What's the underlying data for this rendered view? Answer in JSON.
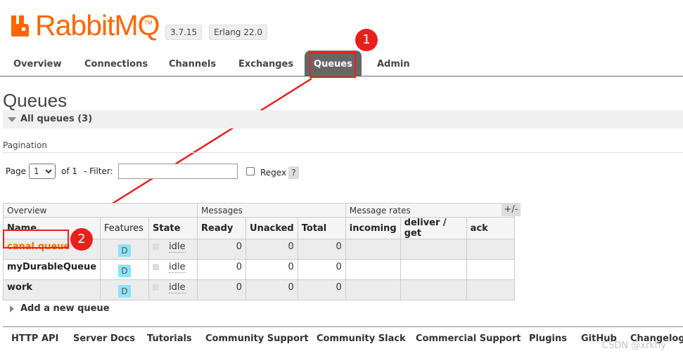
{
  "header": {
    "logo_text": "RabbitMQ",
    "logo_tm": "TM",
    "version": "3.7.15",
    "erlang": "Erlang 22.0"
  },
  "tabs": [
    {
      "label": "Overview"
    },
    {
      "label": "Connections"
    },
    {
      "label": "Channels"
    },
    {
      "label": "Exchanges"
    },
    {
      "label": "Queues",
      "active": true
    },
    {
      "label": "Admin"
    }
  ],
  "page": {
    "title": "Queues",
    "section_title": "All queues (3)"
  },
  "pagination": {
    "label": "Pagination",
    "page_label": "Page",
    "page_value": "1",
    "of_label": "of 1",
    "filter_label": "- Filter:",
    "filter_value": "",
    "regex_label": "Regex",
    "help": "?"
  },
  "table": {
    "groups": [
      "Overview",
      "Messages",
      "Message rates"
    ],
    "plus_minus": "+/-",
    "columns": [
      "Name",
      "Features",
      "State",
      "Ready",
      "Unacked",
      "Total",
      "incoming",
      "deliver / get",
      "ack"
    ],
    "rows": [
      {
        "name": "canal.queue",
        "feature": "D",
        "state": "idle",
        "ready": "0",
        "unacked": "0",
        "total": "0",
        "incoming": "",
        "deliver_get": "",
        "ack": ""
      },
      {
        "name": "myDurableQueue",
        "feature": "D",
        "state": "idle",
        "ready": "0",
        "unacked": "0",
        "total": "0",
        "incoming": "",
        "deliver_get": "",
        "ack": ""
      },
      {
        "name": "work",
        "feature": "D",
        "state": "idle",
        "ready": "0",
        "unacked": "0",
        "total": "0",
        "incoming": "",
        "deliver_get": "",
        "ack": ""
      }
    ]
  },
  "add_queue": "Add a new queue",
  "footer": [
    "HTTP API",
    "Server Docs",
    "Tutorials",
    "Community Support",
    "Community Slack",
    "Commercial Support",
    "Plugins",
    "GitHub",
    "Changelog"
  ],
  "annotations": {
    "marker1": "1",
    "marker2": "2"
  },
  "watermark": "CSDN @xrkhy",
  "colors": {
    "brand": "#ff6600",
    "annotation": "#e8201c",
    "active_tab": "#666666",
    "feature_badge": "#8fe2f8"
  }
}
